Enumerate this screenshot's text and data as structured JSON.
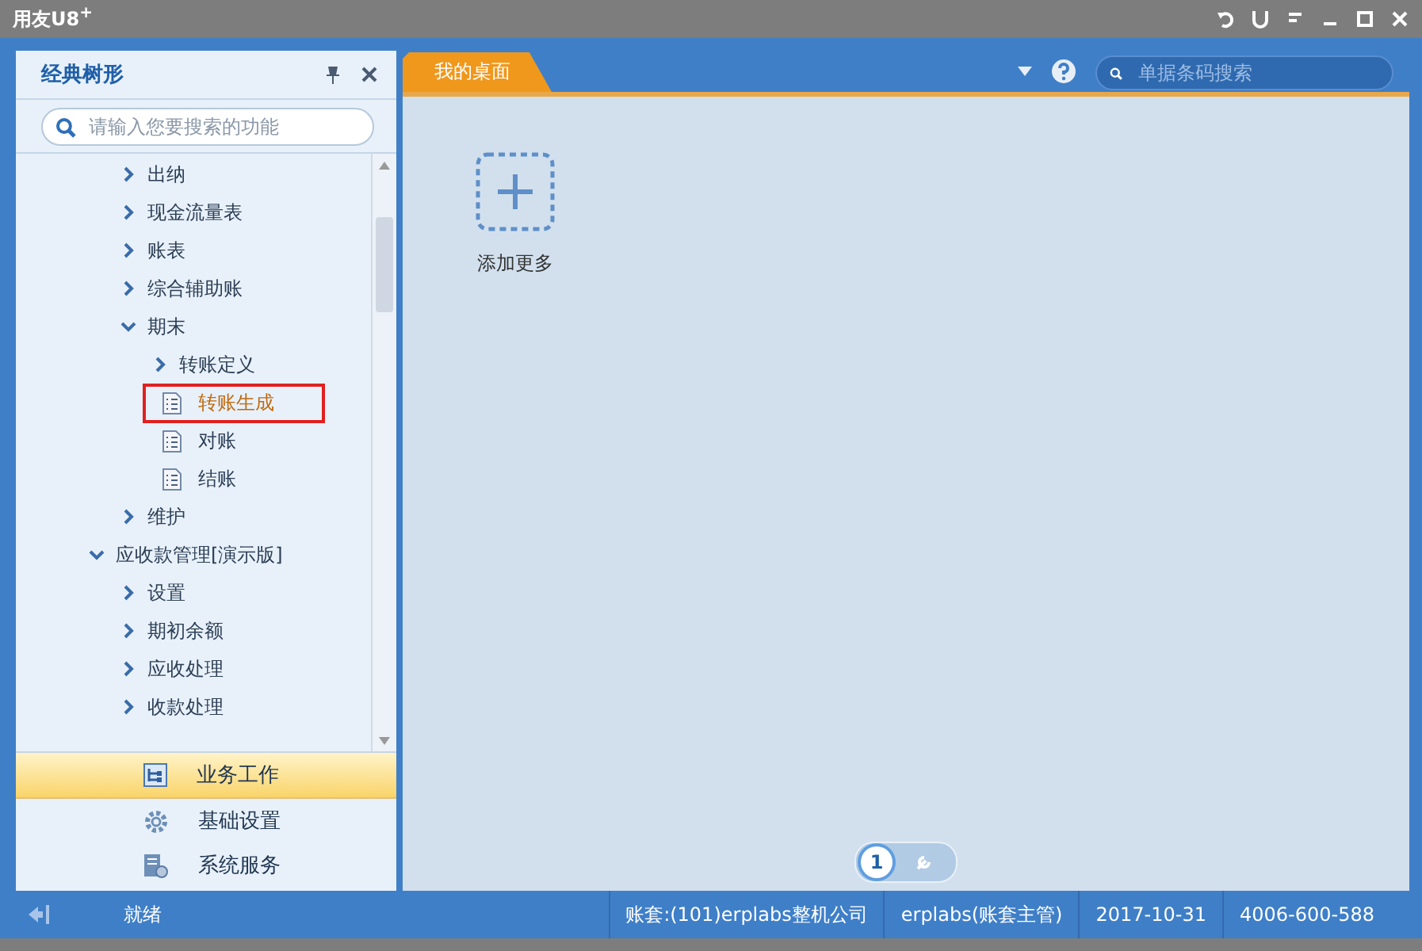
{
  "window": {
    "title": "用友U8",
    "title_sup": "+"
  },
  "tree_panel": {
    "title": "经典树形",
    "search": {
      "placeholder": "请输入您要搜索的功能"
    }
  },
  "tree": [
    {
      "children": [
        {
          "label": "出纳",
          "kind": "folder",
          "expanded": false
        },
        {
          "label": "现金流量表",
          "kind": "folder",
          "expanded": false
        },
        {
          "label": "账表",
          "kind": "folder",
          "expanded": false
        },
        {
          "label": "综合辅助账",
          "kind": "folder",
          "expanded": false
        },
        {
          "label": "期末",
          "kind": "folder",
          "expanded": true,
          "children": [
            {
              "label": "转账定义",
              "kind": "folder",
              "expanded": false
            },
            {
              "label": "转账生成",
              "kind": "leaf",
              "selected": true
            },
            {
              "label": "对账",
              "kind": "leaf",
              "selected": false
            },
            {
              "label": "结账",
              "kind": "leaf",
              "selected": false
            }
          ]
        },
        {
          "label": "维护",
          "kind": "folder",
          "expanded": false
        }
      ]
    },
    {
      "label": "应收款管理[演示版]",
      "kind": "folder",
      "expanded": true,
      "children": [
        {
          "label": "设置",
          "kind": "folder",
          "expanded": false
        },
        {
          "label": "期初余额",
          "kind": "folder",
          "expanded": false
        },
        {
          "label": "应收处理",
          "kind": "folder",
          "expanded": false
        },
        {
          "label": "收款处理",
          "kind": "folder",
          "expanded": false
        }
      ]
    }
  ],
  "nav": [
    {
      "label": "业务工作",
      "kind": "work",
      "selected": true
    },
    {
      "label": "基础设置",
      "kind": "settings",
      "selected": false
    },
    {
      "label": "系统服务",
      "kind": "service",
      "selected": false
    }
  ],
  "tabs": [
    {
      "label": "我的桌面",
      "selected": true
    }
  ],
  "top_search": {
    "placeholder": "单据条码搜索"
  },
  "desktop": {
    "add_label": "添加更多"
  },
  "pager": [
    {
      "label": "1",
      "kind": "page",
      "selected": true
    },
    {
      "kind": "tools",
      "selected": false
    }
  ],
  "status_bar": {
    "state": "就绪",
    "account": "账套:(101)erplabs整机公司",
    "user": "erplabs(账套主管)",
    "date": "2017-10-31",
    "phone": "4006-600-588"
  }
}
